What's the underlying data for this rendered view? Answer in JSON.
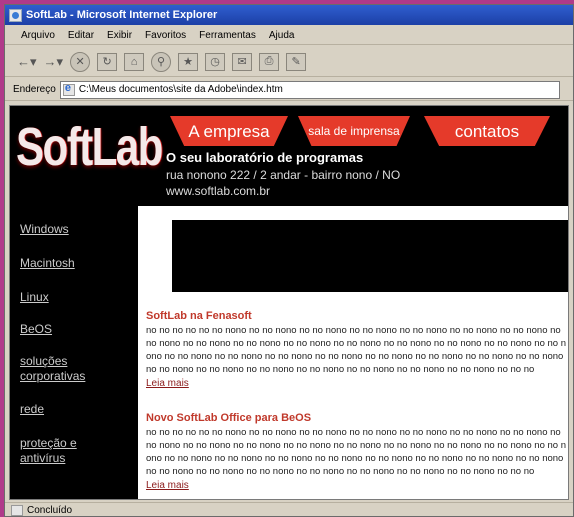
{
  "window": {
    "title": "SoftLab - Microsoft Internet Explorer"
  },
  "menu": [
    "Arquivo",
    "Editar",
    "Exibir",
    "Favoritos",
    "Ferramentas",
    "Ajuda"
  ],
  "address": {
    "label": "Endereço",
    "value": "C:\\Meus documentos\\site da Adobe\\index.htm"
  },
  "status": "Concluído",
  "page": {
    "logo": "SoftLab",
    "nav": {
      "empresa": "A empresa",
      "imprensa": "sala de imprensa",
      "contatos": "contatos"
    },
    "tagline": "O seu laboratório de programas",
    "address": "rua nonono 222 / 2 andar - bairro nono / NO",
    "url": "www.softlab.com.br",
    "sidebar": [
      "Windows",
      "Macintosh",
      "Linux",
      "BeOS",
      "soluções corporativas",
      "rede",
      "proteção e antivírus"
    ],
    "news": [
      {
        "title": "SoftLab na Fenasoft",
        "body": "no no no no no no nono no no nono no no nono no no nono no no nono no no nono no no nono no no nono no no nono no no nono no no nono no no nono no no nono no no nono no no nono no no nono no no nono no no nono no no nono no no nono no no nono no no nono no no nono no no nono no no nono no no nono no no nono no no nono no no nono no no nono no no nono no no no",
        "link": "Leia mais"
      },
      {
        "title": "Novo SoftLab Office para BeOS",
        "body": "no no no no no no nono no no nono no no nono no no nono no no nono no no nono no no nono no no nono no no nono no no nono no no nono no no nono no no nono no no nono no no nono no no nono no no nono no no nono no no nono no no nono no no nono no no nono no no nono no no nono no no nono no no nono no no nono no no nono no no nono no no nono no no nono no no no",
        "link": "Leia mais"
      }
    ]
  }
}
